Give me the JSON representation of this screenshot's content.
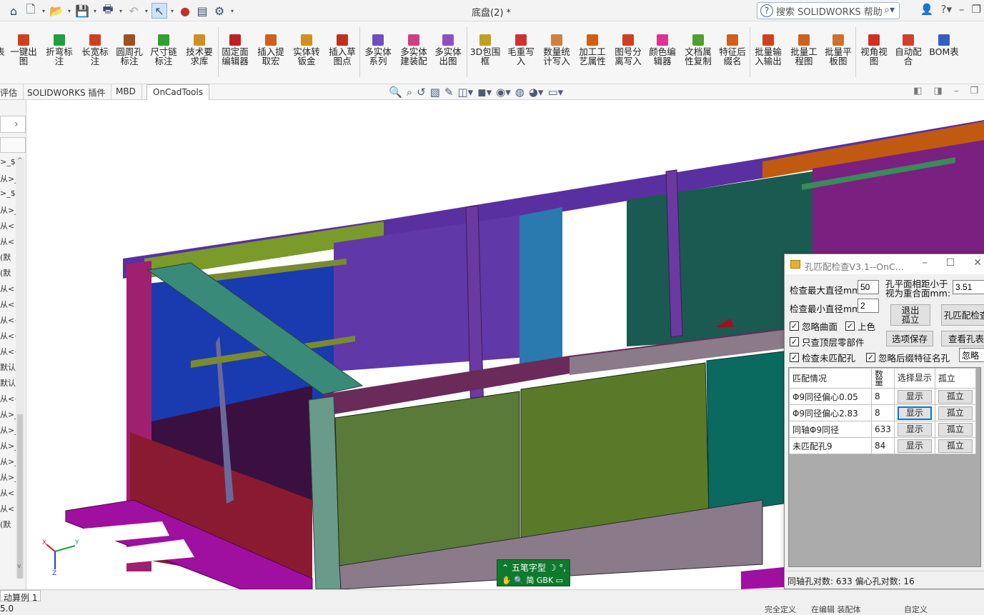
{
  "window": {
    "document_title": "底盘(2) *",
    "search_placeholder": "搜索 SOLIDWORKS 帮助"
  },
  "ribbon": {
    "buttons": [
      {
        "label": "一键出图",
        "color": "#d04020"
      },
      {
        "label": "折弯标注",
        "color": "#20a040"
      },
      {
        "label": "长宽标注",
        "color": "#d04020"
      },
      {
        "label": "圆周孔标注",
        "color": "#a05020"
      },
      {
        "label": "尺寸链标注",
        "color": "#30a030"
      },
      {
        "label": "技术要求库",
        "color": "#d09020"
      },
      {
        "label": "固定面编辑器",
        "color": "#c02020"
      },
      {
        "label": "插入提取宏",
        "color": "#d06020"
      },
      {
        "label": "实体转钣金",
        "color": "#d09020"
      },
      {
        "label": "插入草图点",
        "color": "#c03020"
      },
      {
        "label": "多实体系列",
        "color": "#7050c0"
      },
      {
        "label": "多实体建装配",
        "color": "#d04080"
      },
      {
        "label": "多实体出图",
        "color": "#9050c0"
      },
      {
        "label": "3D包围框",
        "color": "#c0a020"
      },
      {
        "label": "毛重写入",
        "color": "#d03030"
      },
      {
        "label": "数量统计写入",
        "color": "#d08040"
      },
      {
        "label": "加工工艺属性",
        "color": "#d06010"
      },
      {
        "label": "图号分离写入",
        "color": "#d04020"
      },
      {
        "label": "颜色编辑器",
        "color": "#e03090"
      },
      {
        "label": "文档属性复制",
        "color": "#50a030"
      },
      {
        "label": "特征后缀名",
        "color": "#d06020"
      },
      {
        "label": "批量输入输出",
        "color": "#d04020"
      },
      {
        "label": "批量工程图",
        "color": "#d06020"
      },
      {
        "label": "批量平板图",
        "color": "#d07030"
      },
      {
        "label": "视角视图",
        "color": "#d03020"
      },
      {
        "label": "自动配合",
        "color": "#d04030"
      },
      {
        "label": "BOM表",
        "color": "#3060c0"
      }
    ],
    "left_cut_label": "表"
  },
  "tabs": [
    {
      "label": "评估"
    },
    {
      "label": "SOLIDWORKS 插件"
    },
    {
      "label": "MBD"
    },
    {
      "label": "OnCadTools"
    }
  ],
  "left_panel": {
    "rows": [
      ">_$",
      "从>_",
      ">_$",
      "从>_",
      "从<",
      "从<",
      "(默",
      "(默",
      "从<",
      "从<",
      "从<<",
      "从<<",
      "从<<",
      "默认",
      "默认",
      "从<<",
      "从>_",
      "从>_",
      "从>_",
      "从>_",
      "从>_",
      "从<",
      "从<",
      "(默"
    ]
  },
  "dialog": {
    "title": "孔匹配检查V3.1--OnC...",
    "max_dia_label": "检查最大直径mm",
    "max_dia_value": "50",
    "min_dia_label": "检查最小直径mm",
    "min_dia_value": "2",
    "coplanar_label": "孔平面相距小于视为重合面mm:",
    "coplanar_value": "3.51",
    "exit_isolate": "退出孤立",
    "check_button": "孔匹配检查",
    "ignore_surface": "忽略曲面",
    "colorize": "上色",
    "top_parts_only": "只查顶层零部件",
    "save_options": "选项保存",
    "view_hole_table": "查看孔表",
    "check_unmatched": "检查未匹配孔",
    "ignore_suffix": "忽略后缀特征名孔",
    "ignore_value": "忽略",
    "columns": [
      "匹配情况",
      "数量",
      "选择显示",
      "孤立"
    ],
    "rows": [
      {
        "desc": "Φ9同径偏心0.05",
        "count": "8",
        "show": "显示",
        "isolate": "孤立"
      },
      {
        "desc": "Φ9同径偏心2.83",
        "count": "8",
        "show": "显示",
        "isolate": "孤立"
      },
      {
        "desc": "同轴Φ9同径",
        "count": "633",
        "show": "显示",
        "isolate": "孤立"
      },
      {
        "desc": "未匹配孔9",
        "count": "84",
        "show": "显示",
        "isolate": "孤立"
      }
    ],
    "status": "同轴孔对数:   633  偏心孔对数:   16"
  },
  "ime": {
    "line1": "五笔字型",
    "line2": "简 GBK"
  },
  "statusbar": {
    "tab_label": "动算例 1",
    "left_value": "5.0",
    "right_items": [
      "完全定义",
      "在编辑 装配体",
      "自定义"
    ]
  },
  "colors": {
    "accent": "#0078d7",
    "ime_bg": "#0e7a2d"
  }
}
